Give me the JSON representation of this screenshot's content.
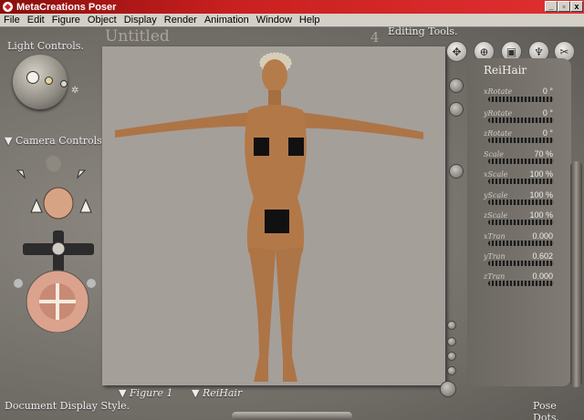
{
  "window": {
    "title": "MetaCreations Poser",
    "buttons": {
      "min": "_",
      "max": "▫",
      "close": "x"
    }
  },
  "menu": [
    "File",
    "Edit",
    "Figure",
    "Object",
    "Display",
    "Render",
    "Animation",
    "Window",
    "Help"
  ],
  "labels": {
    "light_controls": "Light Controls.",
    "camera_controls": "Camera Controls.",
    "document": "Untitled",
    "frame": "4",
    "editing_tools": "Editing Tools.",
    "figure_menu": "Figure 1",
    "element_menu": "ReiHair",
    "document_display": "Document Display Style.",
    "pose_dots": "Pose Dots."
  },
  "param_panel": {
    "title": "ReiHair",
    "params": [
      {
        "name": "xRotate",
        "value": "0 °"
      },
      {
        "name": "yRotate",
        "value": "0 °"
      },
      {
        "name": "zRotate",
        "value": "0 °"
      },
      {
        "name": "Scale",
        "value": "70 %"
      },
      {
        "name": "xScale",
        "value": "100 %"
      },
      {
        "name": "yScale",
        "value": "100 %"
      },
      {
        "name": "zScale",
        "value": "100 %"
      },
      {
        "name": "xTran",
        "value": "0.000"
      },
      {
        "name": "yTran",
        "value": "0.602"
      },
      {
        "name": "zTran",
        "value": "0.000"
      }
    ]
  },
  "colors": {
    "accent": "#c92020",
    "viewport_bg": "#a59f9a",
    "skin": "#b07644",
    "hair_mesh": "#d6cdb8"
  }
}
